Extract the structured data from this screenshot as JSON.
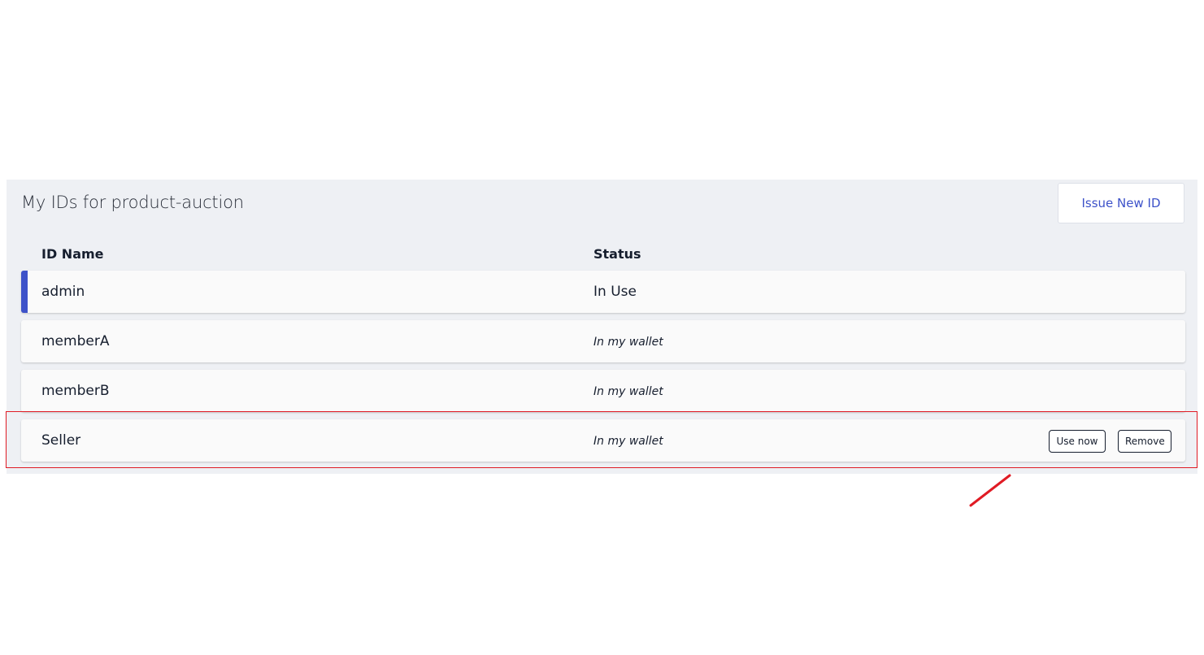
{
  "panel": {
    "title": "My IDs for product-auction",
    "issue_button_label": "Issue New ID"
  },
  "table": {
    "headers": {
      "id_name": "ID Name",
      "status": "Status"
    },
    "rows": [
      {
        "name": "admin",
        "status": "In Use",
        "active": true
      },
      {
        "name": "memberA",
        "status": "In my wallet",
        "active": false
      },
      {
        "name": "memberB",
        "status": "In my wallet",
        "active": false
      },
      {
        "name": "Seller",
        "status": "In my wallet",
        "active": false,
        "actions": {
          "use_now": "Use now",
          "remove": "Remove"
        }
      }
    ]
  },
  "colors": {
    "accent": "#3d52c9",
    "panel_bg": "#eef0f4",
    "annotation": "#e01b24"
  }
}
